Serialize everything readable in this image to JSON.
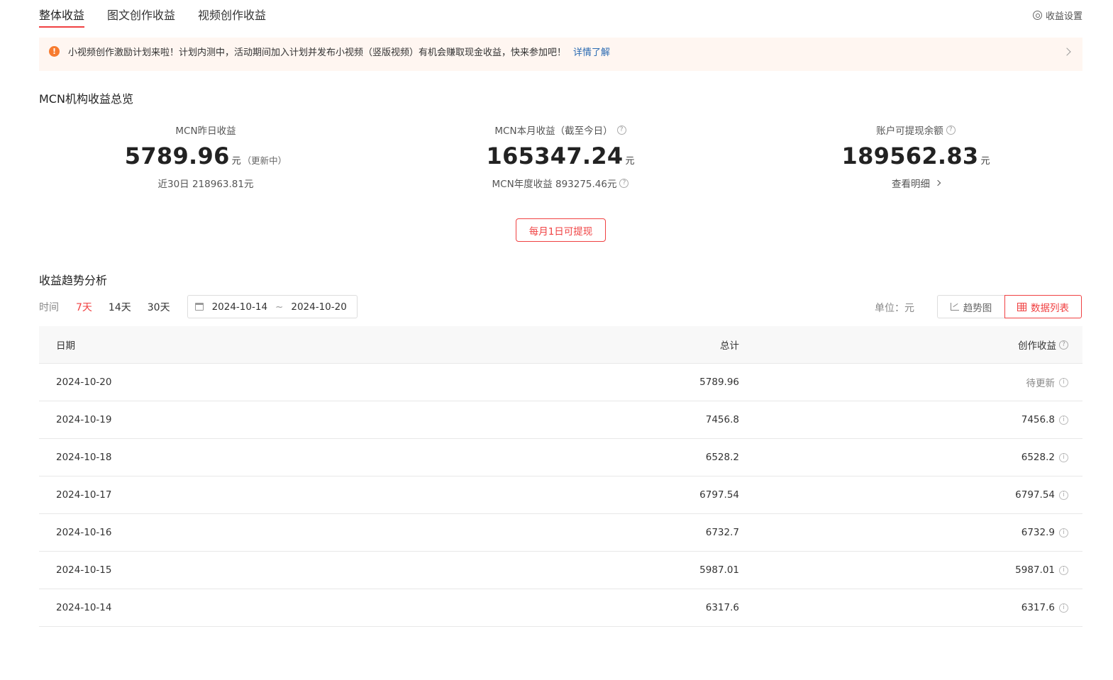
{
  "tabs": [
    {
      "label": "整体收益",
      "active": true
    },
    {
      "label": "图文创作收益",
      "active": false
    },
    {
      "label": "视频创作收益",
      "active": false
    }
  ],
  "settings_label": "收益设置",
  "notice": {
    "text": "小视频创作激励计划来啦！计划内测中，活动期间加入计划并发布小视频（竖版视频）有机会赚取现金收益，快来参加吧！",
    "link": "详情了解"
  },
  "overview": {
    "title": "MCN机构收益总览",
    "yesterday": {
      "label": "MCN昨日收益",
      "value": "5789.96",
      "unit": "元",
      "suffix": "（更新中）",
      "sub": "近30日 218963.81元"
    },
    "month": {
      "label": "MCN本月收益（截至今日）",
      "value": "165347.24",
      "unit": "元",
      "sub": "MCN年度收益 893275.46元"
    },
    "balance": {
      "label": "账户可提现余额",
      "value": "189562.83",
      "unit": "元",
      "sub": "查看明细"
    },
    "withdraw_button": "每月1日可提现"
  },
  "trend": {
    "title": "收益趋势分析",
    "time_label": "时间",
    "ranges": [
      "7天",
      "14天",
      "30天"
    ],
    "active_range": "7天",
    "date_start": "2024-10-14",
    "date_sep": "~",
    "date_end": "2024-10-20",
    "unit_label": "单位：元",
    "view_trend": "趋势图",
    "view_list": "数据列表"
  },
  "table": {
    "headers": {
      "date": "日期",
      "total": "总计",
      "income": "创作收益"
    },
    "rows": [
      {
        "date": "2024-10-20",
        "total": "5789.96",
        "income": "待更新"
      },
      {
        "date": "2024-10-19",
        "total": "7456.8",
        "income": "7456.8"
      },
      {
        "date": "2024-10-18",
        "total": "6528.2",
        "income": "6528.2"
      },
      {
        "date": "2024-10-17",
        "total": "6797.54",
        "income": "6797.54"
      },
      {
        "date": "2024-10-16",
        "total": "6732.7",
        "income": "6732.9"
      },
      {
        "date": "2024-10-15",
        "total": "5987.01",
        "income": "5987.01"
      },
      {
        "date": "2024-10-14",
        "total": "6317.6",
        "income": "6317.6"
      }
    ]
  },
  "colors": {
    "accent": "#f04142",
    "link": "#2a6ab2",
    "notice_bg": "#fff6f1",
    "warn": "#f77b2f"
  },
  "icons": [
    "settings-icon",
    "warning-icon",
    "chevron-right-icon",
    "help-icon",
    "calendar-icon",
    "trend-chart-icon",
    "table-icon",
    "info-icon"
  ]
}
